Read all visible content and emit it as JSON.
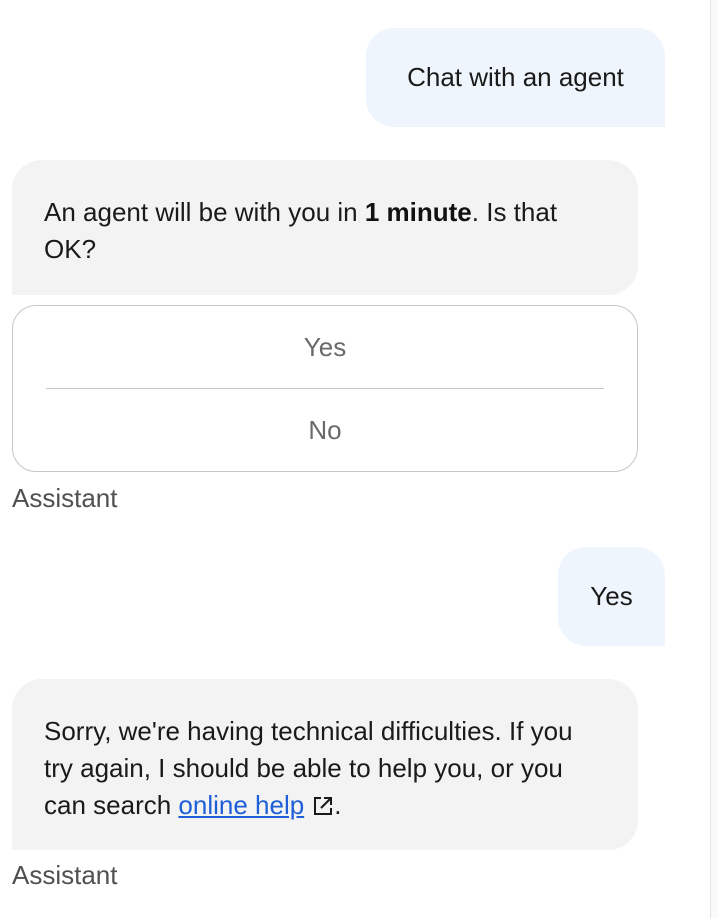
{
  "messages": {
    "user_1": "Chat with an agent",
    "bot_1": {
      "before": "An agent will be with you in ",
      "bold": "1 minute",
      "after": ". Is that OK?"
    },
    "options": [
      "Yes",
      "No"
    ],
    "sender_label_1": "Assistant",
    "user_2": "Yes",
    "bot_2": {
      "before": "Sorry, we're having technical difficulties. If you try again, I should be able to help you, or you can search ",
      "link": "online help",
      "after": "."
    },
    "sender_label_2": "Assistant"
  },
  "icons": {
    "link": "external-link-icon"
  },
  "colors": {
    "user_bubble": "#eff5fd",
    "bot_bubble": "#f3f3f3",
    "link": "#1e5fd9"
  }
}
